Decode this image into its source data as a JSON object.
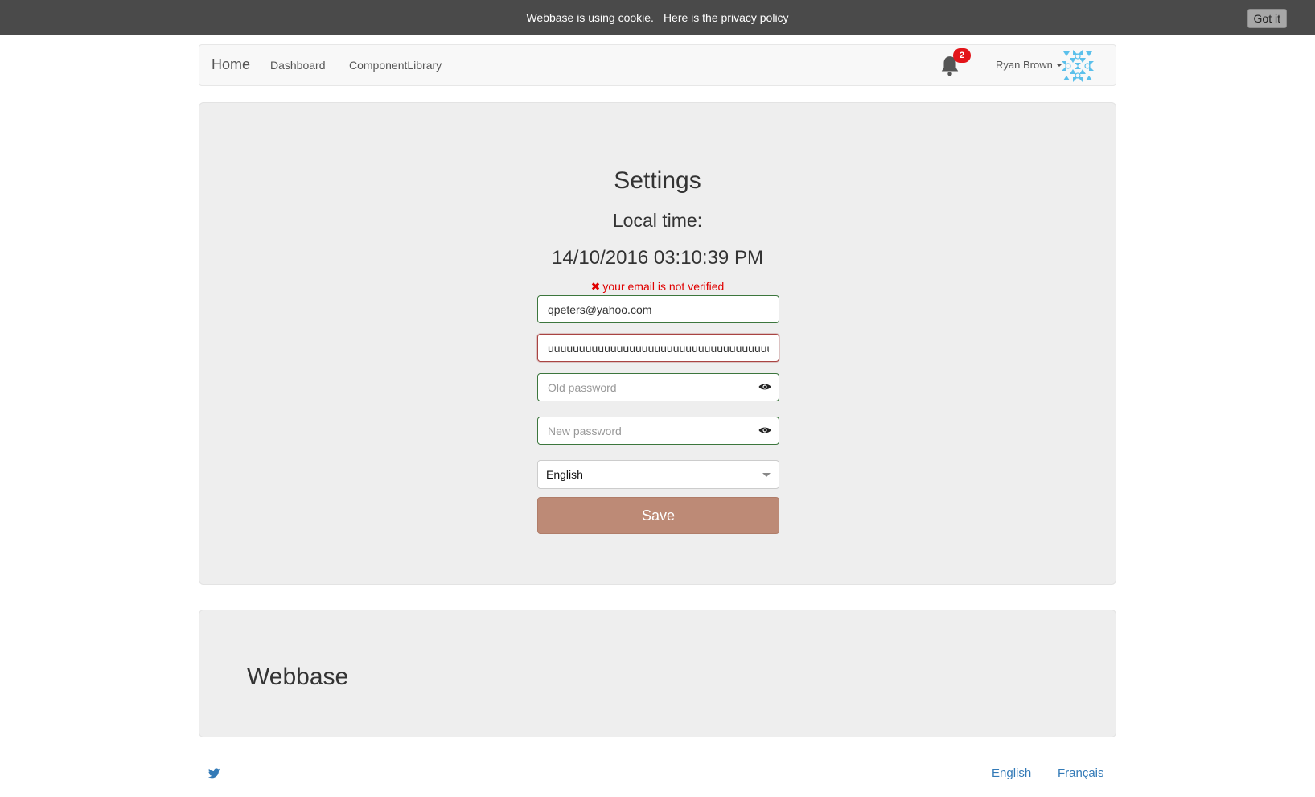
{
  "cookie_bar": {
    "message": "Webbase is using cookie.",
    "policy_link": "Here is the privacy policy",
    "button_label": "Got it"
  },
  "navbar": {
    "brand": "Home",
    "links": [
      "Dashboard",
      "ComponentLibrary"
    ],
    "notification_count": "2",
    "user_name": "Ryan Brown",
    "icons": {
      "notifications": "bell-icon",
      "user_menu": "caret-down-icon",
      "avatar": "identicon-avatar"
    }
  },
  "settings": {
    "title": "Settings",
    "local_time_label": "Local time:",
    "local_time_value": "14/10/2016 03:10:39 PM",
    "email_warning": "your email is not verified",
    "email_value": "qpeters@yahoo.com",
    "username_value": "uuuuuuuuuuuuuuuuuuuuuuuuuuuuuuuuuuuu",
    "old_password_placeholder": "Old password",
    "new_password_placeholder": "New password",
    "language_selected": "English",
    "save_label": "Save"
  },
  "footer": {
    "brand": "Webbase",
    "languages": [
      "English",
      "Français"
    ],
    "social_icon": "twitter-icon"
  },
  "colors": {
    "cookie_bar_bg": "#4a4a4a",
    "panel_bg": "#eeeeee",
    "valid_border": "#3c763d",
    "error_border": "#a94442",
    "warning_text": "#e00000",
    "save_button": "#bd8a76",
    "badge": "#e3151a",
    "link": "#337ab7",
    "avatar": "#5bc0eb"
  }
}
